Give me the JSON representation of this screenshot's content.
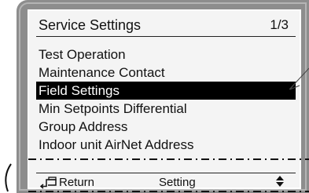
{
  "screen": {
    "title": "Service Settings",
    "page_indicator": "1/3"
  },
  "menu": {
    "items": [
      "Test Operation",
      "Maintenance Contact",
      "Field Settings",
      "Min Setpoints Differential",
      "Group Address",
      "Indoor unit AirNet Address"
    ],
    "selected_index": 2
  },
  "footer": {
    "return_label": "Return",
    "setting_label": "Setting",
    "return_icon": "return-icon",
    "updown_icon": "up-down-arrows-icon"
  }
}
